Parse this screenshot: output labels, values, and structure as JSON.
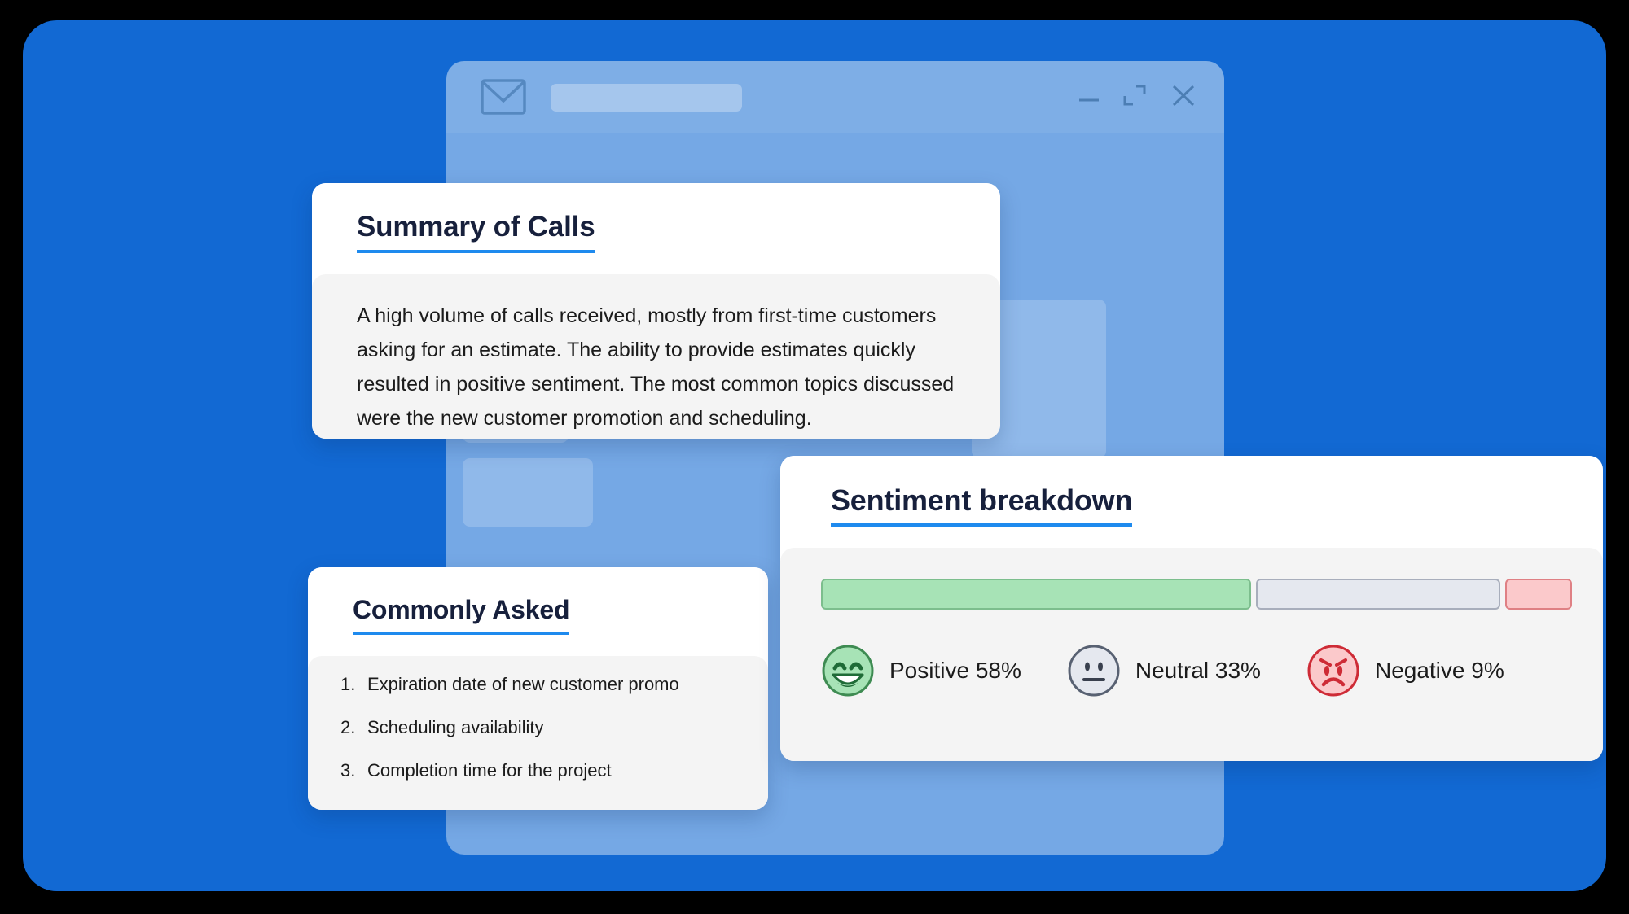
{
  "theme": {
    "stage_blue": "#1269D3",
    "accent_blue": "#1E8AEE",
    "title_navy": "#17203C",
    "card_body_gray": "#F4F4F4",
    "positive_fill": "#A7E3B6",
    "positive_stroke": "#3E8B52",
    "neutral_fill": "#E5E8EF",
    "neutral_stroke": "#586172",
    "negative_fill": "#FBC9CB",
    "negative_stroke": "#CE2B36"
  },
  "window": {
    "app_icon": "envelope-icon",
    "title_placeholder": "",
    "controls": {
      "minimize": "minimize-icon",
      "maximize": "maximize-icon",
      "close": "close-icon"
    }
  },
  "summary_card": {
    "title": "Summary of Calls",
    "text": "A high volume of calls received, mostly from first-time customers asking for an estimate. The ability to provide estimates quickly resulted in positive sentiment. The most common topics discussed were the new customer promotion and scheduling."
  },
  "commonly_asked_card": {
    "title": "Commonly Asked",
    "items": [
      "Expiration date of new customer promo",
      "Scheduling availability",
      "Completion time for the project"
    ]
  },
  "sentiment_card": {
    "title": "Sentiment breakdown",
    "legend": [
      {
        "icon": "smiling-face-icon",
        "label": "Positive 58%"
      },
      {
        "icon": "neutral-face-icon",
        "label": "Neutral 33%"
      },
      {
        "icon": "angry-face-icon",
        "label": "Negative 9%"
      }
    ]
  },
  "chart_data": {
    "type": "bar",
    "title": "Sentiment breakdown",
    "orientation": "horizontal-stacked",
    "categories": [
      "Positive",
      "Neutral",
      "Negative"
    ],
    "values": [
      58,
      33,
      9
    ],
    "unit": "%",
    "labels": [
      "Positive 58%",
      "Neutral 33%",
      "Negative 9%"
    ],
    "colors": [
      "#A7E3B6",
      "#E5E8EF",
      "#FBC9CB"
    ],
    "stroke_colors": [
      "#7CBE8D",
      "#A8AEBC",
      "#DF8084"
    ],
    "xlabel": "",
    "ylabel": "",
    "xlim": [
      0,
      100
    ],
    "grid": false,
    "legend_position": "bottom"
  }
}
